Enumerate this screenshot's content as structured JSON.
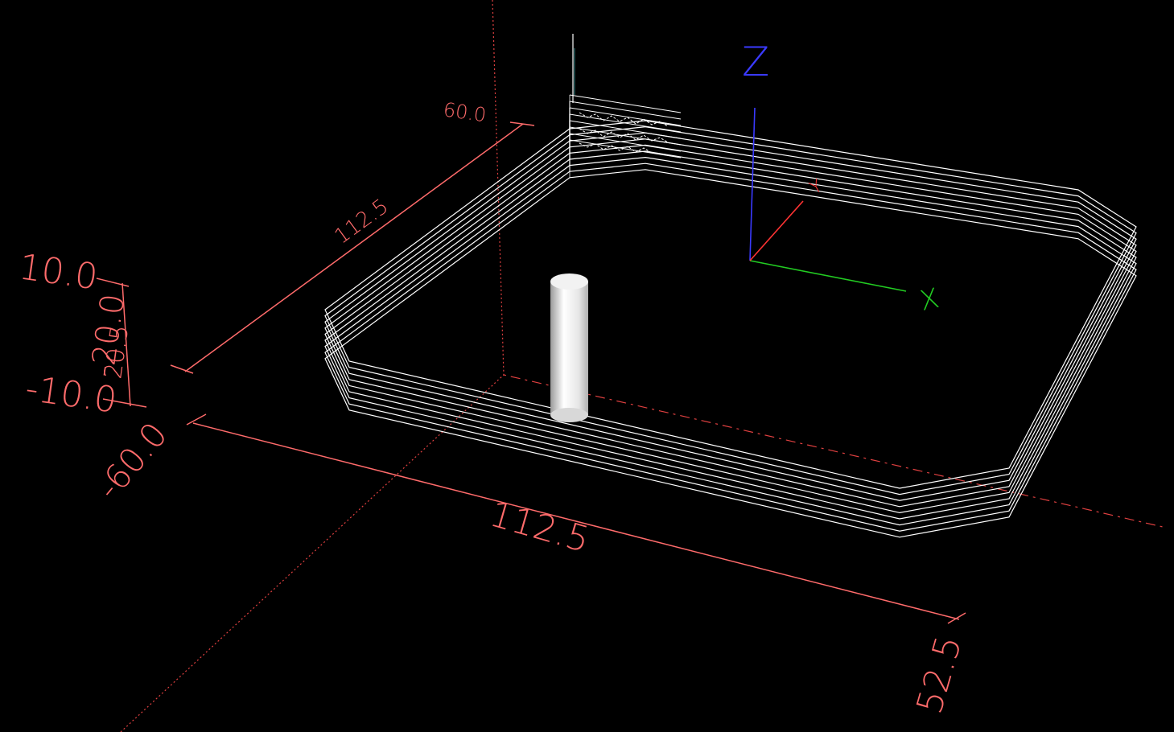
{
  "viewer": {
    "background": "#000000",
    "extents_color": "#ff6b6b",
    "toolpath_color": "#ffffff",
    "tool_color": "#ffffff"
  },
  "extents": {
    "z_max": "10.0",
    "z_min": "-10.0",
    "z_mid": "-20.0",
    "z_span": "20.5",
    "x_min": "-60.0",
    "x_span": "112.5",
    "x_max": "52.5",
    "y_max": "60.0",
    "y_span": "112.5"
  },
  "axes": {
    "z_label": "Z",
    "x_label": "X",
    "y_label": "Y",
    "z_color": "#3a3aff",
    "x_color": "#22cc22",
    "y_color": "#ff3333"
  }
}
